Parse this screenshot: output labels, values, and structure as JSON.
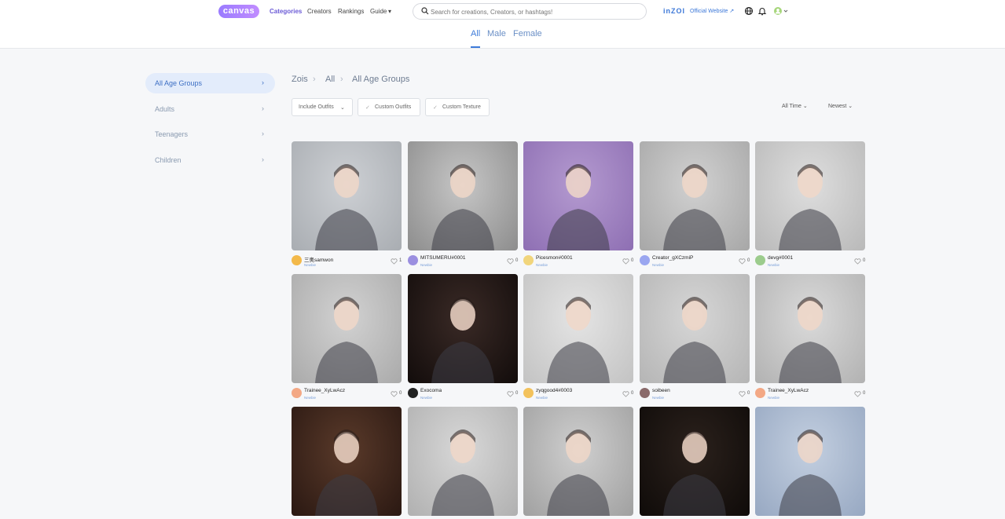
{
  "header": {
    "logo": "canvas",
    "nav": [
      "Categories",
      "Creators",
      "Rankings",
      "Guide"
    ],
    "guide_caret": "▾",
    "search_placeholder": "Search for creations, Creators, or hashtags!",
    "brand": "inZOI",
    "official_link": "Official Website ↗"
  },
  "gender_tabs": [
    "All",
    "Male",
    "Female"
  ],
  "sidebar": {
    "items": [
      {
        "label": "All Age Groups",
        "active": true
      },
      {
        "label": "Adults",
        "active": false
      },
      {
        "label": "Teenagers",
        "active": false
      },
      {
        "label": "Children",
        "active": false
      }
    ],
    "chevron": "›"
  },
  "breadcrumb": [
    "Zois",
    "All",
    "All Age Groups"
  ],
  "breadcrumb_sep": "›",
  "filters": {
    "include_outfits": "Include Outfits",
    "custom_outfits": "Custom Outfits",
    "custom_texture": "Custom Texture",
    "time": "All Time",
    "order": "Newest"
  },
  "label_text": "Newbie",
  "cards": [
    {
      "creator": "三奥samwon",
      "likes": "1",
      "bg": [
        "#cdd0d4",
        "#a9adb2"
      ],
      "avatar": "#f3b94a"
    },
    {
      "creator": "MITSUMERU#0001",
      "likes": "0",
      "bg": [
        "#c6c6c6",
        "#8d8d8d"
      ],
      "avatar": "#9b8fe0"
    },
    {
      "creator": "Picesmon#0001",
      "likes": "0",
      "bg": [
        "#b49ad0",
        "#8e6fb3"
      ],
      "avatar": "#f1d57c"
    },
    {
      "creator": "Creator_gXCzmiP",
      "likes": "0",
      "bg": [
        "#d1d1d1",
        "#a7a7a7"
      ],
      "avatar": "#9aa6f0"
    },
    {
      "creator": "devg#0001",
      "likes": "0",
      "bg": [
        "#dedede",
        "#b9b9b9"
      ],
      "avatar": "#9ccc8d"
    },
    {
      "creator": "Trainee_XyLwAcz",
      "likes": "0",
      "bg": [
        "#d2d2d2",
        "#aaaaaa"
      ],
      "avatar": "#f3a885"
    },
    {
      "creator": "Exocoma",
      "likes": "0",
      "bg": [
        "#3a2a26",
        "#120c0b"
      ],
      "avatar": "#222222"
    },
    {
      "creator": "zyqgood4#0003",
      "likes": "0",
      "bg": [
        "#e4e4e4",
        "#c3c3c3"
      ],
      "avatar": "#f3c25c"
    },
    {
      "creator": "soibeen",
      "likes": "0",
      "bg": [
        "#d6d6d6",
        "#b5b5b5"
      ],
      "avatar": "#8a6a6a"
    },
    {
      "creator": "Trainee_XyLwAcz",
      "likes": "0",
      "bg": [
        "#dadada",
        "#b2b2b2"
      ],
      "avatar": "#f3a885"
    },
    {
      "creator": "",
      "likes": "",
      "bg": [
        "#5a3a2a",
        "#2a1812"
      ],
      "avatar": ""
    },
    {
      "creator": "",
      "likes": "",
      "bg": [
        "#d8d8d8",
        "#b0b0b0"
      ],
      "avatar": ""
    },
    {
      "creator": "",
      "likes": "",
      "bg": [
        "#cfcfcf",
        "#a0a0a0"
      ],
      "avatar": ""
    },
    {
      "creator": "",
      "likes": "",
      "bg": [
        "#2b211c",
        "#0f0b09"
      ],
      "avatar": ""
    },
    {
      "creator": "",
      "likes": "",
      "bg": [
        "#c3cfe0",
        "#97a8c2"
      ],
      "avatar": ""
    }
  ],
  "colors": {
    "accent": "#3d7bd9",
    "brand": "#9a7bff"
  }
}
